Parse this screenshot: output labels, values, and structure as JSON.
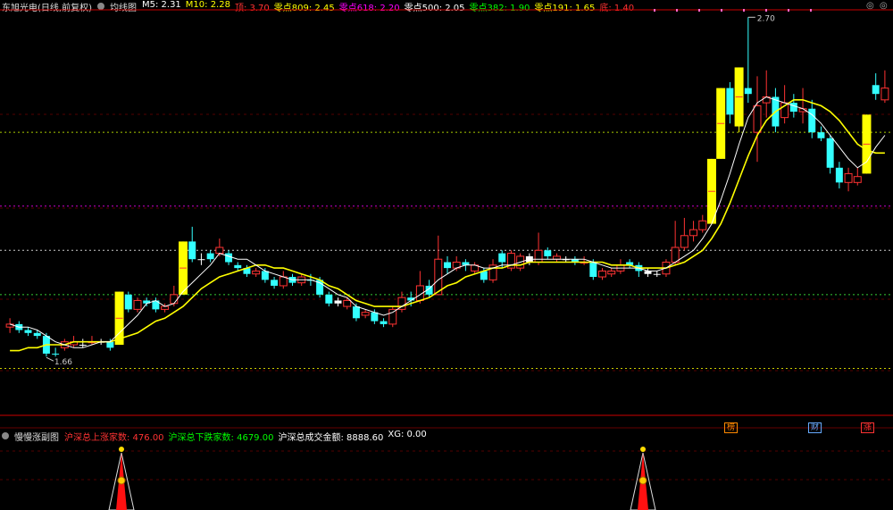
{
  "header": {
    "stock_name": "东旭光电(日线,前复权)",
    "ma_title": "均线图",
    "indicators": [
      {
        "label": "M5: 2.31",
        "color": "#ffffff"
      },
      {
        "label": "M10: 2.28",
        "color": "#ffff00"
      },
      {
        "label": "顶: 3.70",
        "color": "#ff3333"
      },
      {
        "label": "零点809: 2.45",
        "color": "#ffff00"
      },
      {
        "label": "零点618: 2.20",
        "color": "#ff00ff"
      },
      {
        "label": "零点500: 2.05",
        "color": "#ffffff"
      },
      {
        "label": "零点382: 1.90",
        "color": "#00ff00"
      },
      {
        "label": "零点191: 1.65",
        "color": "#ffff00"
      },
      {
        "label": "底: 1.40",
        "color": "#ff3333"
      }
    ]
  },
  "subchart": {
    "title": "慢慢涨副图",
    "indicators": [
      {
        "label": "沪深总上涨家数: 476.00",
        "color": "#ff3333"
      },
      {
        "label": "沪深总下跌家数: 4679.00",
        "color": "#00ff00"
      },
      {
        "label": "沪深总成交金额: 8888.60",
        "color": "#ffffff"
      },
      {
        "label": "XG: 0.00",
        "color": "#ffffff"
      }
    ]
  },
  "annotations": {
    "high_label": "2.70",
    "low_label": "1.66"
  },
  "bottom_flags": [
    {
      "label": "榜",
      "color": "#ff8800"
    },
    {
      "label": "财",
      "color": "#66aaff"
    },
    {
      "label": "涨",
      "color": "#ff3333"
    }
  ],
  "window_controls": {
    "settings": "◎",
    "close": "◎"
  },
  "colors": {
    "up": "#ff3333",
    "down": "#33ffff",
    "limit_up": "#ffff00",
    "ma5": "#ffffff",
    "ma10": "#ffff00"
  },
  "chart_data": {
    "type": "candlestick",
    "ylim": [
      1.5,
      2.85
    ],
    "levels": [
      {
        "name": "零点809",
        "value": 2.45,
        "color": "#aacc00"
      },
      {
        "name": "零点618",
        "value": 2.2,
        "color": "#cc00cc"
      },
      {
        "name": "零点500",
        "value": 2.05,
        "color": "#cccccc"
      },
      {
        "name": "零点382",
        "value": 1.9,
        "color": "#33cc33"
      },
      {
        "name": "零点191",
        "value": 1.65,
        "color": "#cccc00"
      }
    ],
    "candles": [
      [
        1.79,
        1.8,
        1.82,
        1.77,
        "up"
      ],
      [
        1.8,
        1.78,
        1.81,
        1.77,
        "down"
      ],
      [
        1.78,
        1.77,
        1.79,
        1.76,
        "down"
      ],
      [
        1.77,
        1.76,
        1.78,
        1.75,
        "down"
      ],
      [
        1.76,
        1.7,
        1.77,
        1.69,
        "down"
      ],
      [
        1.7,
        1.7,
        1.72,
        1.69,
        "down"
      ],
      [
        1.72,
        1.74,
        1.75,
        1.71,
        "up"
      ],
      [
        1.73,
        1.74,
        1.76,
        1.72,
        "up"
      ],
      [
        1.73,
        1.73,
        1.75,
        1.72,
        "cross"
      ],
      [
        1.74,
        1.74,
        1.76,
        1.73,
        "up"
      ],
      [
        1.74,
        1.74,
        1.75,
        1.73,
        "cross"
      ],
      [
        1.74,
        1.72,
        1.75,
        1.71,
        "down"
      ],
      [
        1.73,
        1.91,
        1.91,
        1.73,
        "limit"
      ],
      [
        1.9,
        1.85,
        1.91,
        1.84,
        "down"
      ],
      [
        1.85,
        1.88,
        1.89,
        1.84,
        "up"
      ],
      [
        1.88,
        1.87,
        1.89,
        1.86,
        "down"
      ],
      [
        1.88,
        1.85,
        1.89,
        1.84,
        "down"
      ],
      [
        1.85,
        1.86,
        1.87,
        1.84,
        "up"
      ],
      [
        1.87,
        1.9,
        1.93,
        1.86,
        "up"
      ],
      [
        1.9,
        2.08,
        2.08,
        1.9,
        "limit"
      ],
      [
        2.08,
        2.02,
        2.13,
        2.01,
        "down"
      ],
      [
        2.02,
        2.02,
        2.04,
        2.0,
        "cross"
      ],
      [
        2.02,
        2.04,
        2.05,
        2.01,
        "down"
      ],
      [
        2.04,
        2.06,
        2.09,
        2.03,
        "up"
      ],
      [
        2.04,
        2.01,
        2.05,
        2.0,
        "down"
      ],
      [
        2.0,
        1.99,
        2.01,
        1.98,
        "down"
      ],
      [
        1.99,
        1.97,
        2.0,
        1.96,
        "down"
      ],
      [
        1.97,
        1.98,
        1.99,
        1.96,
        "up"
      ],
      [
        1.98,
        1.95,
        1.99,
        1.94,
        "down"
      ],
      [
        1.95,
        1.93,
        1.96,
        1.92,
        "down"
      ],
      [
        1.93,
        1.96,
        1.98,
        1.92,
        "up"
      ],
      [
        1.96,
        1.94,
        1.97,
        1.93,
        "down"
      ],
      [
        1.94,
        1.96,
        1.97,
        1.93,
        "up"
      ],
      [
        1.95,
        1.95,
        1.97,
        1.93,
        "down"
      ],
      [
        1.95,
        1.9,
        1.96,
        1.89,
        "down"
      ],
      [
        1.9,
        1.87,
        1.91,
        1.86,
        "down"
      ],
      [
        1.87,
        1.88,
        1.89,
        1.86,
        "cross"
      ],
      [
        1.88,
        1.86,
        1.89,
        1.85,
        "up"
      ],
      [
        1.86,
        1.82,
        1.87,
        1.81,
        "down"
      ],
      [
        1.83,
        1.84,
        1.85,
        1.82,
        "up"
      ],
      [
        1.84,
        1.81,
        1.85,
        1.8,
        "down"
      ],
      [
        1.81,
        1.8,
        1.82,
        1.79,
        "down"
      ],
      [
        1.8,
        1.85,
        1.86,
        1.79,
        "up"
      ],
      [
        1.85,
        1.89,
        1.91,
        1.84,
        "up"
      ],
      [
        1.89,
        1.88,
        1.91,
        1.86,
        "down"
      ],
      [
        1.88,
        1.93,
        1.98,
        1.87,
        "up"
      ],
      [
        1.93,
        1.9,
        1.95,
        1.89,
        "down"
      ],
      [
        1.9,
        2.02,
        2.1,
        1.9,
        "up"
      ],
      [
        2.01,
        1.99,
        2.03,
        1.97,
        "down"
      ],
      [
        1.99,
        2.01,
        2.03,
        1.98,
        "up"
      ],
      [
        2.01,
        2.0,
        2.02,
        1.98,
        "down"
      ],
      [
        2.0,
        1.98,
        2.01,
        1.97,
        "up"
      ],
      [
        1.98,
        1.95,
        1.99,
        1.94,
        "down"
      ],
      [
        1.95,
        2.0,
        2.02,
        1.94,
        "up"
      ],
      [
        2.01,
        2.04,
        2.05,
        1.99,
        "down"
      ],
      [
        2.04,
        1.99,
        2.05,
        1.98,
        "up"
      ],
      [
        1.99,
        2.03,
        2.04,
        1.98,
        "up"
      ],
      [
        2.03,
        2.01,
        2.04,
        2.0,
        "cross"
      ],
      [
        2.01,
        2.05,
        2.11,
        2.0,
        "up"
      ],
      [
        2.05,
        2.03,
        2.06,
        2.02,
        "down"
      ],
      [
        2.03,
        2.02,
        2.04,
        2.01,
        "up"
      ],
      [
        2.02,
        2.02,
        2.03,
        2.01,
        "cross"
      ],
      [
        2.02,
        2.01,
        2.03,
        2.0,
        "down"
      ],
      [
        2.01,
        2.01,
        2.03,
        2.0,
        "up"
      ],
      [
        2.01,
        1.96,
        2.02,
        1.95,
        "down"
      ],
      [
        1.96,
        1.98,
        1.99,
        1.95,
        "up"
      ],
      [
        1.97,
        1.98,
        1.99,
        1.96,
        "up"
      ],
      [
        1.98,
        2.0,
        2.02,
        1.97,
        "up"
      ],
      [
        2.0,
        2.01,
        2.02,
        1.99,
        "down"
      ],
      [
        2.0,
        1.98,
        2.01,
        1.96,
        "down"
      ],
      [
        1.98,
        1.97,
        1.99,
        1.96,
        "cross"
      ],
      [
        1.97,
        1.97,
        1.98,
        1.96,
        "cross"
      ],
      [
        1.97,
        2.01,
        2.02,
        1.96,
        "up"
      ],
      [
        2.01,
        2.06,
        2.15,
        2.0,
        "up"
      ],
      [
        2.06,
        2.1,
        2.16,
        2.05,
        "up"
      ],
      [
        2.1,
        2.12,
        2.15,
        2.08,
        "up"
      ],
      [
        2.12,
        2.15,
        2.17,
        2.11,
        "up"
      ],
      [
        2.14,
        2.36,
        2.36,
        2.14,
        "limit"
      ],
      [
        2.36,
        2.6,
        2.6,
        2.36,
        "limit"
      ],
      [
        2.6,
        2.51,
        2.62,
        2.48,
        "down"
      ],
      [
        2.47,
        2.67,
        2.67,
        2.45,
        "limit"
      ],
      [
        2.6,
        2.58,
        2.84,
        2.55,
        "down"
      ],
      [
        2.45,
        2.54,
        2.64,
        2.35,
        "up"
      ],
      [
        2.55,
        2.57,
        2.66,
        2.5,
        "up"
      ],
      [
        2.57,
        2.47,
        2.6,
        2.45,
        "down"
      ],
      [
        2.5,
        2.55,
        2.61,
        2.48,
        "up"
      ],
      [
        2.55,
        2.52,
        2.58,
        2.5,
        "down"
      ],
      [
        2.52,
        2.53,
        2.6,
        2.48,
        "up"
      ],
      [
        2.53,
        2.45,
        2.56,
        2.43,
        "down"
      ],
      [
        2.45,
        2.43,
        2.47,
        2.42,
        "down"
      ],
      [
        2.43,
        2.33,
        2.44,
        2.31,
        "down"
      ],
      [
        2.33,
        2.28,
        2.35,
        2.26,
        "down"
      ],
      [
        2.28,
        2.31,
        2.33,
        2.25,
        "up"
      ],
      [
        2.28,
        2.3,
        2.33,
        2.27,
        "up"
      ],
      [
        2.31,
        2.51,
        2.51,
        2.31,
        "limit"
      ],
      [
        2.58,
        2.61,
        2.65,
        2.56,
        "down"
      ],
      [
        2.6,
        2.56,
        2.66,
        2.55,
        "up"
      ]
    ],
    "ma5": [
      1.8,
      1.79,
      1.79,
      1.78,
      1.76,
      1.74,
      1.73,
      1.72,
      1.72,
      1.73,
      1.74,
      1.74,
      1.77,
      1.8,
      1.83,
      1.87,
      1.88,
      1.86,
      1.87,
      1.91,
      1.94,
      1.97,
      2.0,
      2.04,
      2.03,
      2.02,
      2.02,
      2.0,
      1.98,
      1.97,
      1.96,
      1.95,
      1.95,
      1.95,
      1.94,
      1.92,
      1.9,
      1.89,
      1.86,
      1.85,
      1.84,
      1.83,
      1.84,
      1.86,
      1.88,
      1.9,
      1.92,
      1.95,
      1.97,
      1.99,
      2.0,
      2.0,
      1.99,
      1.99,
      2.0,
      2.0,
      2.01,
      2.02,
      2.02,
      2.02,
      2.02,
      2.02,
      2.02,
      2.02,
      2.01,
      2.0,
      1.99,
      1.99,
      1.99,
      1.99,
      1.98,
      1.98,
      1.99,
      2.01,
      2.03,
      2.05,
      2.09,
      2.14,
      2.22,
      2.31,
      2.41,
      2.5,
      2.55,
      2.57,
      2.56,
      2.55,
      2.54,
      2.53,
      2.51,
      2.48,
      2.44,
      2.4,
      2.36,
      2.33,
      2.35,
      2.4,
      2.44
    ],
    "ma10": [
      1.71,
      1.71,
      1.72,
      1.72,
      1.73,
      1.73,
      1.73,
      1.74,
      1.74,
      1.74,
      1.74,
      1.74,
      1.75,
      1.76,
      1.77,
      1.79,
      1.81,
      1.82,
      1.84,
      1.86,
      1.89,
      1.92,
      1.94,
      1.96,
      1.97,
      1.98,
      1.99,
      2.0,
      2.0,
      1.99,
      1.99,
      1.98,
      1.97,
      1.96,
      1.95,
      1.93,
      1.92,
      1.9,
      1.88,
      1.87,
      1.86,
      1.86,
      1.86,
      1.86,
      1.87,
      1.88,
      1.89,
      1.91,
      1.93,
      1.94,
      1.96,
      1.97,
      1.98,
      1.99,
      1.99,
      2.0,
      2.0,
      2.01,
      2.01,
      2.01,
      2.01,
      2.01,
      2.01,
      2.01,
      2.01,
      2.01,
      2.0,
      2.0,
      2.0,
      1.99,
      1.99,
      1.99,
      1.99,
      2.0,
      2.01,
      2.03,
      2.05,
      2.09,
      2.14,
      2.21,
      2.29,
      2.37,
      2.44,
      2.49,
      2.52,
      2.54,
      2.56,
      2.56,
      2.55,
      2.54,
      2.52,
      2.49,
      2.45,
      2.41,
      2.39,
      2.38,
      2.38
    ]
  }
}
